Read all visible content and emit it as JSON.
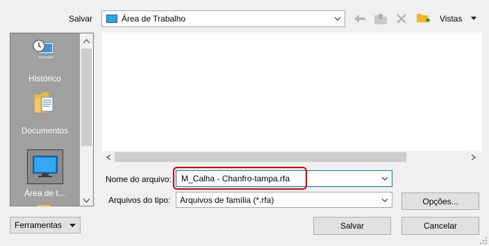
{
  "dialog": {
    "save_in_label": "Salvar",
    "location": "Área de Trabalho",
    "toolbar": {
      "views_label": "Vistas"
    },
    "places": [
      {
        "label": "Histórico",
        "icon": "history-icon"
      },
      {
        "label": "Documentos",
        "icon": "documents-folder-icon"
      },
      {
        "label": "Área de t...",
        "icon": "desktop-icon"
      }
    ],
    "file_name_label": "Nome do arquivo:",
    "file_name_value": "M_Calha - Chanfro-tampa.rfa",
    "file_type_label": "Arquivos do tipo:",
    "file_type_value": "Arquivos de família  (*.rfa)",
    "options_button": "Opções...",
    "tools_button": "Ferramentas",
    "save_button": "Salvar",
    "cancel_button": "Cancelar",
    "highlight_color": "#e00000",
    "accent_color": "#0078d7"
  }
}
